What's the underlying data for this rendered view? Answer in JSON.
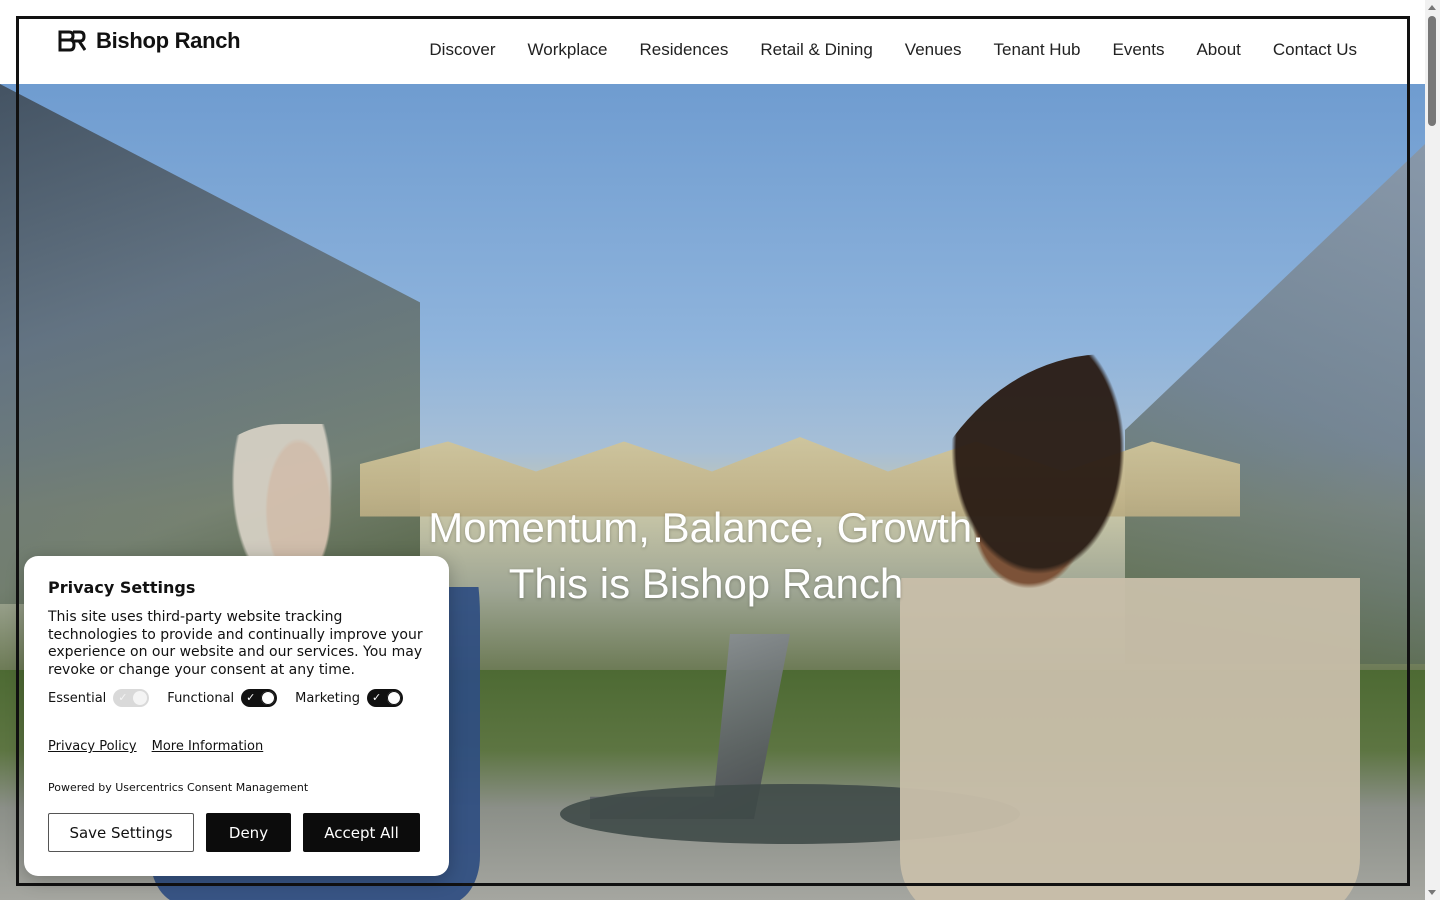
{
  "brand": {
    "name": "Bishop Ranch",
    "logo_mark": "BR"
  },
  "nav": {
    "items": [
      {
        "label": "Discover"
      },
      {
        "label": "Workplace"
      },
      {
        "label": "Residences"
      },
      {
        "label": "Retail & Dining"
      },
      {
        "label": "Venues"
      },
      {
        "label": "Tenant Hub"
      },
      {
        "label": "Events"
      },
      {
        "label": "About"
      },
      {
        "label": "Contact Us"
      }
    ]
  },
  "hero": {
    "line1": "Momentum, Balance, Growth.",
    "line2": "This is Bishop Ranch"
  },
  "consent": {
    "title": "Privacy Settings",
    "description": "This site uses third-party website tracking technologies to provide and continually improve your experience on our website and our services. You may revoke or change your consent at any time.",
    "toggles": [
      {
        "label": "Essential",
        "state": "on-disabled"
      },
      {
        "label": "Functional",
        "state": "on"
      },
      {
        "label": "Marketing",
        "state": "on"
      }
    ],
    "links": {
      "privacy_policy": "Privacy Policy",
      "more_info": "More Information"
    },
    "powered_by": "Powered by Usercentrics Consent Management",
    "buttons": {
      "save": "Save Settings",
      "deny": "Deny",
      "accept": "Accept All"
    }
  },
  "colors": {
    "accent": "#0c0c0c",
    "background": "#ffffff"
  }
}
